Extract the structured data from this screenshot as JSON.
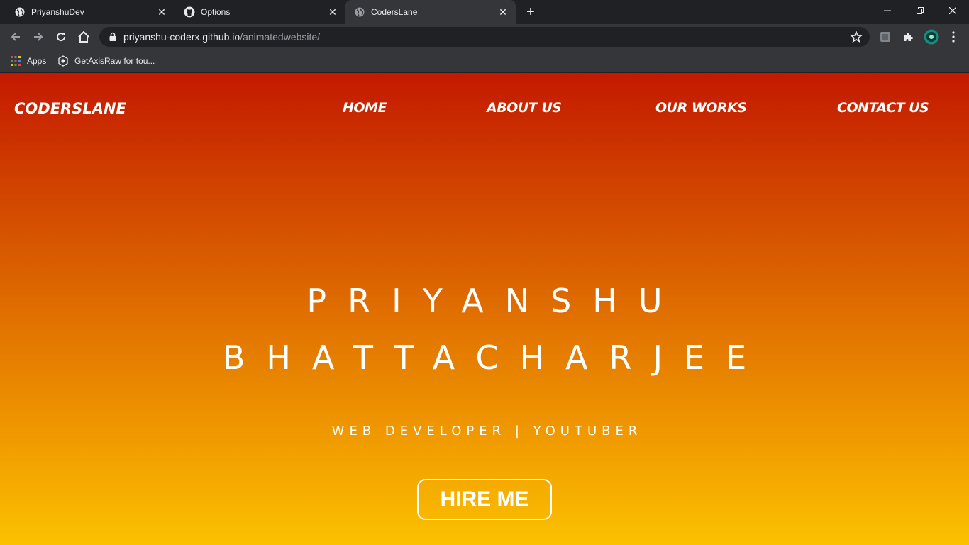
{
  "browser": {
    "tabs": [
      {
        "title": "PriyanshuDev",
        "icon": "globe-icon",
        "active": false
      },
      {
        "title": "Options",
        "icon": "github-icon",
        "active": false
      },
      {
        "title": "CodersLane",
        "icon": "globe-icon",
        "active": true
      }
    ],
    "address": {
      "host": "priyanshu-coderx.github.io",
      "path": "/animatedwebsite/"
    },
    "bookmarks": [
      {
        "label": "Apps",
        "icon": "apps-grid-icon"
      },
      {
        "label": "GetAxisRaw for tou...",
        "icon": "unity-icon"
      }
    ]
  },
  "site": {
    "logo": "CODERSLANE",
    "nav": [
      "HOME",
      "ABOUT US",
      "OUR WORKS",
      "CONTACT US"
    ],
    "headline_line1": "PRIYANSHU",
    "headline_line2": "BHATTACHARJEE",
    "subtitle": "WEB DEVELOPER | YOUTUBER",
    "cta": "HIRE ME"
  },
  "colors": {
    "gradient_top": "#c41900",
    "gradient_bottom": "#fcc100",
    "chrome_dark": "#202124",
    "chrome_toolbar": "#35363a"
  }
}
